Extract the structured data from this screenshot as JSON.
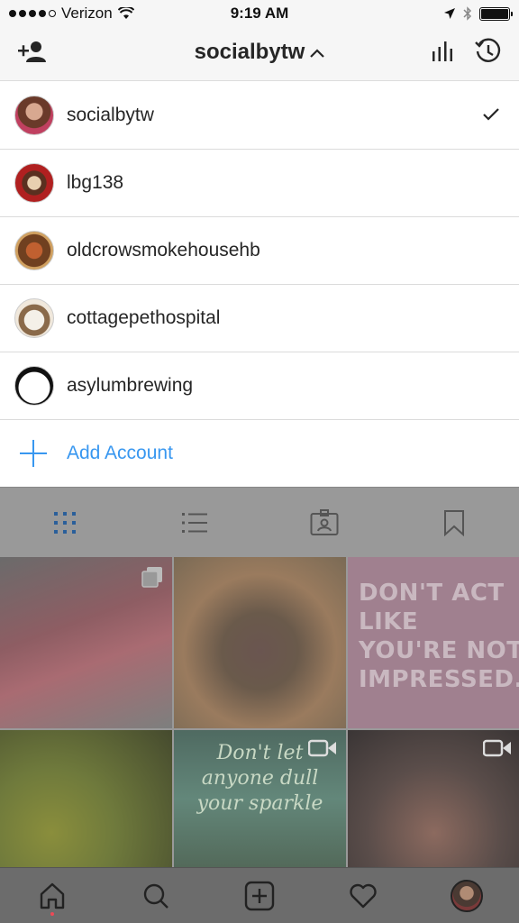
{
  "status_bar": {
    "carrier": "Verizon",
    "time": "9:19 AM"
  },
  "header": {
    "title": "socialbytw",
    "add_person_icon": "add-person-icon",
    "insights_icon": "bar-chart-icon",
    "archive_icon": "history-icon"
  },
  "accounts": [
    {
      "name": "socialbytw",
      "selected": true,
      "avatar_color": "#c07a6a"
    },
    {
      "name": "lbg138",
      "selected": false,
      "avatar_color": "#7a2a1a"
    },
    {
      "name": "oldcrowsmokehousehb",
      "selected": false,
      "avatar_color": "#a06030"
    },
    {
      "name": "cottagepethospital",
      "selected": false,
      "avatar_color": "#d8c8b0"
    },
    {
      "name": "asylumbrewing",
      "selected": false,
      "avatar_color": "#111111"
    }
  ],
  "add_account": {
    "label": "Add Account"
  },
  "profile_tabs": [
    "grid-icon",
    "list-icon",
    "tagged-icon",
    "bookmark-icon"
  ],
  "posts": [
    {
      "kind": "photo",
      "multi": true
    },
    {
      "kind": "photo"
    },
    {
      "kind": "quote",
      "text": "DON'T ACT LIKE YOU'RE NOT IMPRESSED."
    },
    {
      "kind": "photo"
    },
    {
      "kind": "video",
      "text": "Don't let anyone dull your sparkle"
    },
    {
      "kind": "video"
    }
  ],
  "bottom_nav": [
    "home-icon",
    "search-icon",
    "new-post-icon",
    "heart-icon",
    "profile-avatar"
  ],
  "colors": {
    "accent": "#3897f0",
    "notification": "#ed4956",
    "bar_background": "#f6f6f6"
  }
}
